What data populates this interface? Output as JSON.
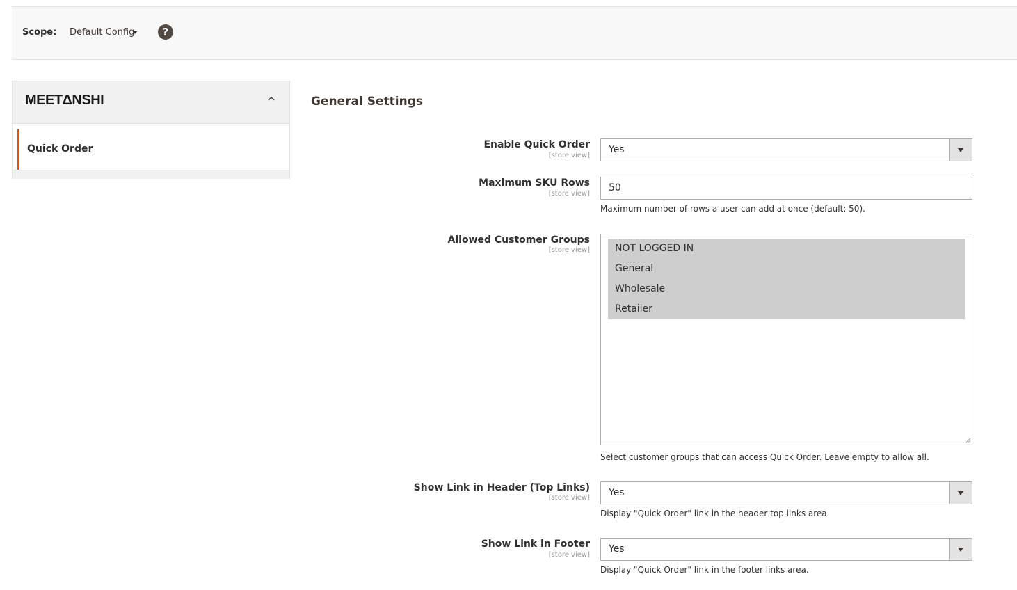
{
  "scope": {
    "label": "Scope:",
    "value": "Default Config",
    "help_icon": "question-circle-icon",
    "help_glyph": "?"
  },
  "sidebar": {
    "brand": "MEETΔNSHI",
    "collapse_icon": "chevron-up-icon",
    "items": [
      {
        "label": "Quick Order",
        "active": true
      }
    ],
    "accent_color": "#eb5202"
  },
  "main": {
    "section_title": "General Settings",
    "fields": {
      "enable_quick_order": {
        "label": "Enable Quick Order",
        "scope": "[store view]",
        "value": "Yes"
      },
      "max_sku_rows": {
        "label": "Maximum SKU Rows",
        "scope": "[store view]",
        "value": "50",
        "note": "Maximum number of rows a user can add at once (default: 50)."
      },
      "allowed_groups": {
        "label": "Allowed Customer Groups",
        "scope": "[store view]",
        "options": [
          "NOT LOGGED IN",
          "General",
          "Wholesale",
          "Retailer"
        ],
        "note": "Select customer groups that can access Quick Order. Leave empty to allow all."
      },
      "show_header_link": {
        "label": "Show Link in Header (Top Links)",
        "scope": "[store view]",
        "value": "Yes",
        "note": "Display \"Quick Order\" link in the header top links area."
      },
      "show_footer_link": {
        "label": "Show Link in Footer",
        "scope": "[store view]",
        "value": "Yes",
        "note": "Display \"Quick Order\" link in the footer links area."
      }
    }
  }
}
